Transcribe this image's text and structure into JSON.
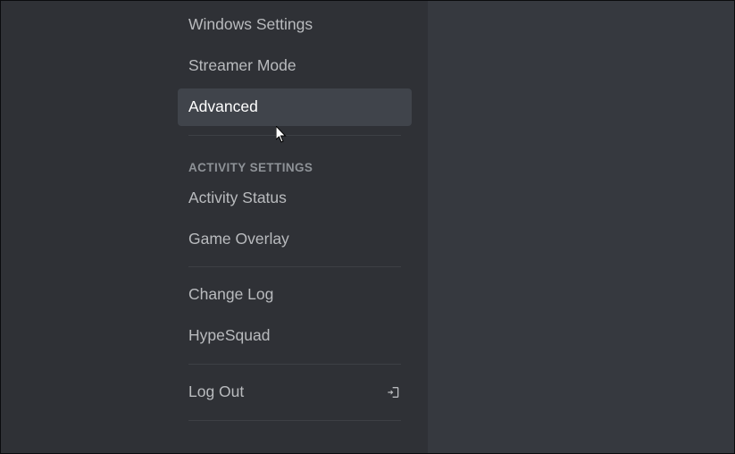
{
  "sidebar": {
    "items": [
      "Windows Settings",
      "Streamer Mode",
      "Advanced"
    ],
    "activity_header": "ACTIVITY SETTINGS",
    "activity_items": [
      "Activity Status",
      "Game Overlay"
    ],
    "misc_items": [
      "Change Log",
      "HypeSquad"
    ],
    "logout_label": "Log Out"
  }
}
